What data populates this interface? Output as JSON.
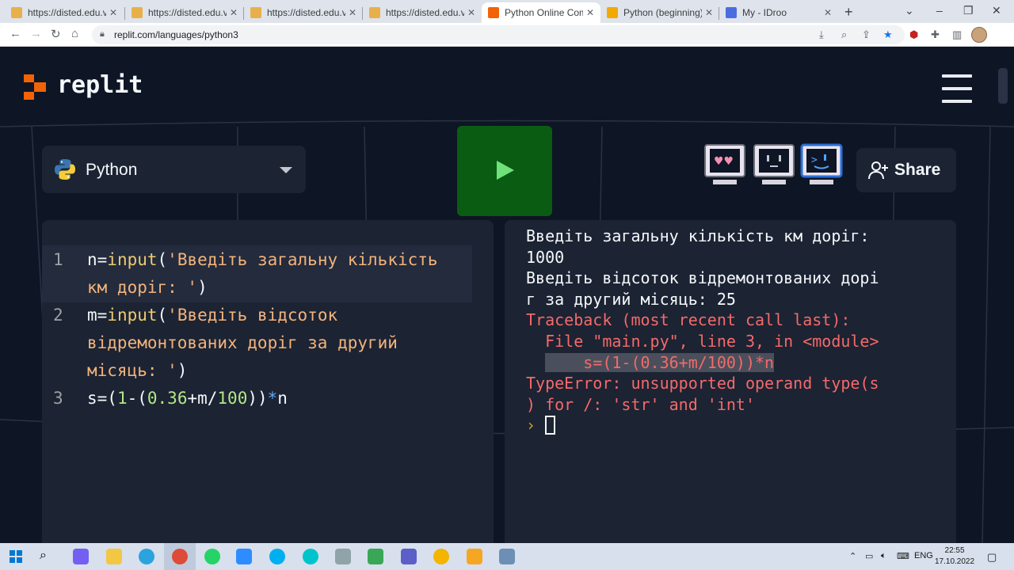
{
  "browser": {
    "tabs": [
      {
        "title": "https://disted.edu.vn/",
        "favicon_color": "#e8b04a"
      },
      {
        "title": "https://disted.edu.vn/",
        "favicon_color": "#e8b04a"
      },
      {
        "title": "https://disted.edu.vn/",
        "favicon_color": "#e8b04a"
      },
      {
        "title": "https://disted.edu.vn/",
        "favicon_color": "#e8b04a"
      },
      {
        "title": "Python Online Compi",
        "favicon_color": "#f26207"
      },
      {
        "title": "Python (beginning).de",
        "favicon_color": "#f2a900"
      },
      {
        "title": "My - IDroo",
        "favicon_color": "#4a6ee0"
      }
    ],
    "new_tab": "+",
    "url": "replit.com/languages/python3"
  },
  "replit": {
    "logo_text": "replit",
    "language_label": "Python",
    "share_label": "Share",
    "accent_run": "#0a5c13"
  },
  "editor": {
    "lines": [
      {
        "num": "1"
      },
      {
        "num": "2"
      },
      {
        "num": "3"
      }
    ],
    "tokens": {
      "l1_a": "n=",
      "l1_fn": "input",
      "l1_b": "(",
      "l1_str": "'Введіть загальну кількість км доріг: '",
      "l1_c": ")",
      "l2_a": "m=",
      "l2_fn": "input",
      "l2_b": "(",
      "l2_str": "'Введіть відсоток відремонтованих доріг за другий місяць: '",
      "l2_c": ")",
      "l3_a": "s=(",
      "l3_n1": "1",
      "l3_b": "-(",
      "l3_n2": "0.36",
      "l3_c": "+m/",
      "l3_n3": "100",
      "l3_d": "))",
      "l3_op": "*",
      "l3_e": "n"
    }
  },
  "console": {
    "line1": "Введіть загальну кількість км доріг:",
    "line2": "1000",
    "line3": "Введіть відсоток відремонтованих дорі",
    "line4": "г за другий місяць: 25",
    "line5": "Traceback (most recent call last):",
    "line6": "  File \"main.py\", line 3, in <module>",
    "line7": "    s=(1-(0.36+m/100))*n",
    "line8": "TypeError: unsupported operand type(s",
    "line9": ") for /: 'str' and 'int'",
    "prompt": "›"
  },
  "taskbar": {
    "lang": "ENG",
    "time": "22:55",
    "date": "17.10.2022"
  }
}
